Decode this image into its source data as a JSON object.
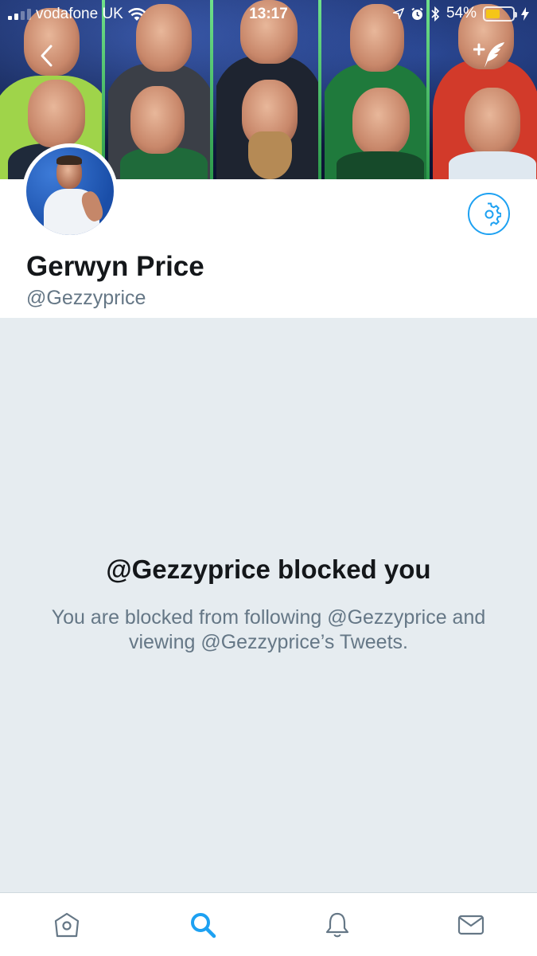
{
  "status_bar": {
    "carrier": "vodafone UK",
    "time": "13:17",
    "battery": "54%",
    "battery_level": 0.54
  },
  "nav": {
    "back_icon": "chevron-left-icon",
    "compose_icon": "compose-tweet-icon"
  },
  "profile": {
    "display_name": "Gerwyn Price",
    "handle": "@Gezzyprice",
    "settings_icon": "gear-icon"
  },
  "blocked": {
    "title": "@Gezzyprice blocked you",
    "description": "You are blocked from following @Gezzyprice and viewing @Gezzyprice’s Tweets."
  },
  "tab_bar": {
    "items": [
      {
        "icon": "home-icon",
        "active": false
      },
      {
        "icon": "search-icon",
        "active": true
      },
      {
        "icon": "notifications-icon",
        "active": false
      },
      {
        "icon": "messages-icon",
        "active": false
      }
    ]
  },
  "colors": {
    "accent": "#1da1f2",
    "background": "#e6ecf0",
    "text_primary": "#14171a",
    "text_secondary": "#657786"
  }
}
